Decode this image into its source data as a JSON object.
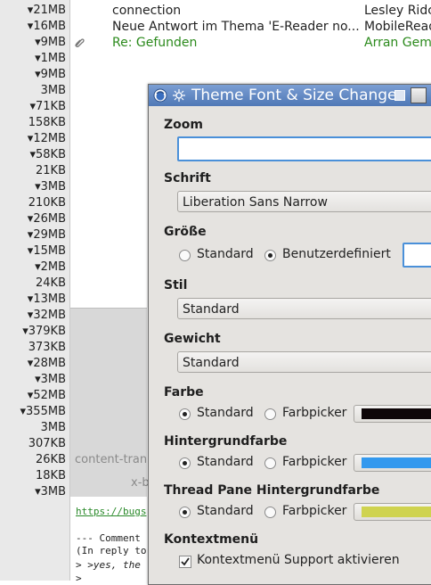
{
  "sizes": [
    "▾21MB",
    "▾16MB",
    "▾9MB",
    "▾1MB",
    "▾9MB",
    "3MB",
    "▾71KB",
    "158KB",
    "▾12MB",
    "▾58KB",
    "21KB",
    "▾3MB",
    "210KB",
    "▾26MB",
    "▾29MB",
    "▾15MB",
    "▾2MB",
    "24KB",
    "▾13MB",
    "▾32MB",
    "▾379KB",
    "373KB",
    "▾28MB",
    "▾3MB",
    "▾52MB",
    "▾355MB",
    "3MB",
    "307KB",
    "26KB",
    "18KB",
    "▾3MB"
  ],
  "messages": [
    {
      "subject": "connection",
      "author": "Lesley Ridc"
    },
    {
      "subject": "Neue Antwort im Thema 'E-Reader no...",
      "author": "MobileRead"
    },
    {
      "subject": "Re: Gefunden",
      "author": "Arran Gems"
    }
  ],
  "preview": {
    "header_line_1": "content-tran",
    "header_line_2": "x-b",
    "link": "https://bugs",
    "body_lines": [
      "--- Comment",
      "(In reply to",
      "> >yes, the",
      ">"
    ]
  },
  "dialog": {
    "title": "Theme Font & Size Changer",
    "zoom": {
      "label": "Zoom",
      "value": ""
    },
    "font": {
      "label": "Schrift",
      "value": "Liberation Sans Narrow"
    },
    "size": {
      "label": "Größe",
      "opt_default": "Standard",
      "opt_custom": "Benutzerdefiniert",
      "selected": "custom"
    },
    "style": {
      "label": "Stil",
      "value": "Standard"
    },
    "weight": {
      "label": "Gewicht",
      "value": "Standard"
    },
    "color": {
      "label": "Farbe",
      "opt_default": "Standard",
      "opt_picker": "Farbpicker",
      "swatch": "#0e0608"
    },
    "bg_color": {
      "label": "Hintergrundfarbe",
      "opt_default": "Standard",
      "opt_picker": "Farbpicker",
      "swatch": "#3399ee"
    },
    "thread_bg": {
      "label": "Thread Pane Hintergrundfarbe",
      "opt_default": "Standard",
      "opt_picker": "Farbpicker",
      "swatch": "#cfd34f"
    },
    "context_menu": {
      "label": "Kontextmenü",
      "checkbox_label": "Kontextmenü Support aktivieren",
      "checked": true
    }
  },
  "colors": {
    "unread": "#2b8a1c",
    "titlebar": "#4f78b6",
    "focus": "#4a90d9"
  }
}
